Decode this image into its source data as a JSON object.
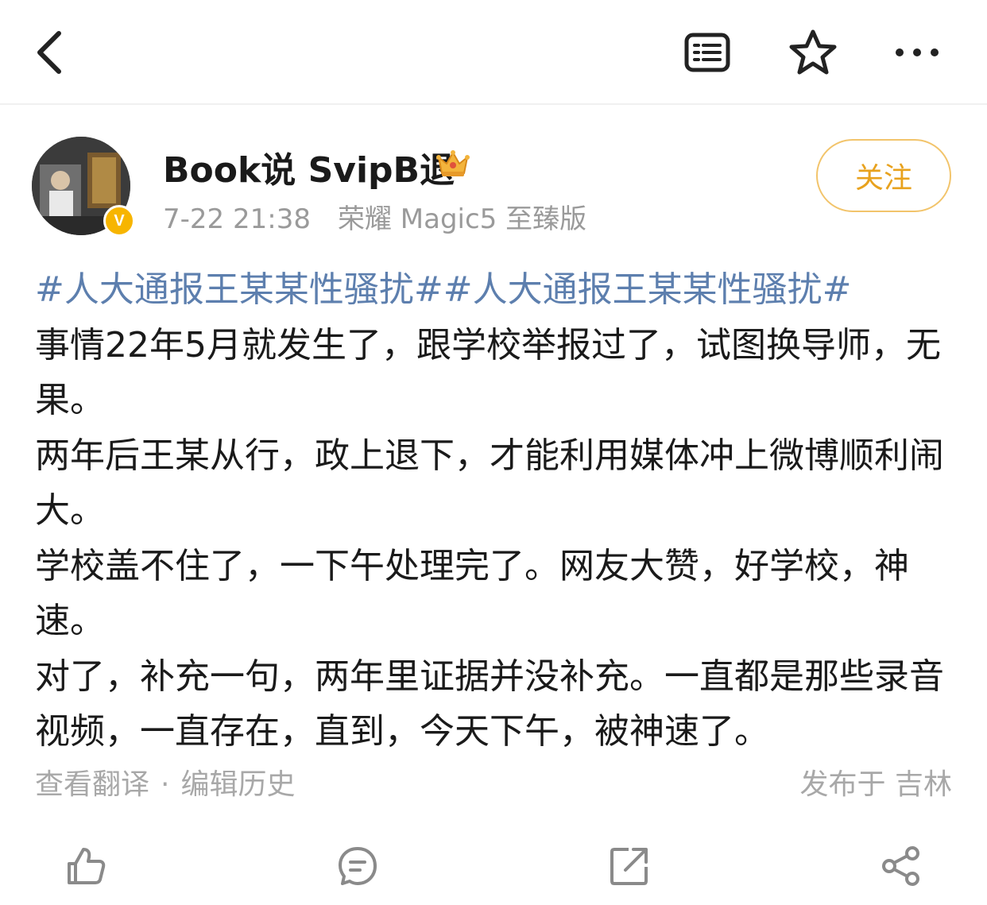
{
  "navbar": {
    "back_icon": "chevron-left-icon",
    "reader_icon": "reader-mode-icon",
    "star_icon": "star-icon",
    "more_icon": "more-icon"
  },
  "author": {
    "name": "Book说 SvipB退",
    "time": "7-22 21:38",
    "device": "荣耀 Magic5 至臻版",
    "verified_badge": "V",
    "follow_label": "关注"
  },
  "post": {
    "hashtags": "#人大通报王某某性骚扰##人大通报王某某性骚扰#",
    "paragraphs": [
      "事情22年5月就发生了，跟学校举报过了，试图换导师，无果。",
      "两年后王某从行，政上退下，才能利用媒体冲上微博顺利闹大。",
      "学校盖不住了，一下午处理完了。网友大赞，好学校，神速。",
      "对了，补充一句，两年里证据并没补充。一直都是那些录音视频，一直存在，直到，今天下午，被神速了。"
    ]
  },
  "footer": {
    "translate_label": "查看翻译",
    "separator": "·",
    "edit_history_label": "编辑历史",
    "location_label": "发布于 吉林"
  },
  "actions": {
    "like_icon": "like-icon",
    "comment_icon": "comment-icon",
    "repost_icon": "repost-icon",
    "share_icon": "share-icon"
  },
  "colors": {
    "hashtag": "#5d7fae",
    "follow": "#e8a21e",
    "meta": "#9a9a9a"
  }
}
